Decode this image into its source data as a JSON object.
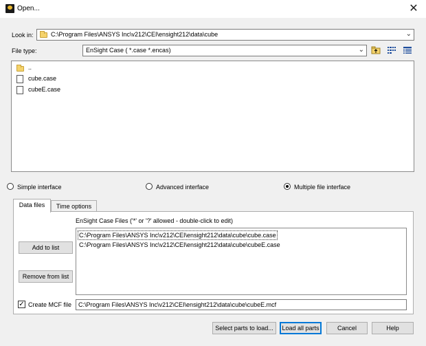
{
  "window": {
    "title": "Open...",
    "close_icon": "close-icon"
  },
  "look_in": {
    "label": "Look in:",
    "value": "C:\\Program Files\\ANSYS Inc\\v212\\CEI\\ensight212\\data\\cube"
  },
  "file_type": {
    "label": "File type:",
    "value": "EnSight Case ( *.case *.encas)"
  },
  "toolbar": {
    "icons": [
      "up-folder-icon",
      "list-view-icon",
      "detail-view-icon"
    ]
  },
  "file_list": {
    "items": [
      {
        "name": "..",
        "icon": "folder-icon"
      },
      {
        "name": "cube.case",
        "icon": "file-icon"
      },
      {
        "name": "cubeE.case",
        "icon": "file-icon"
      }
    ]
  },
  "interface": {
    "options": [
      "Simple interface",
      "Advanced interface",
      "Multiple file interface"
    ],
    "selected": "Multiple file interface"
  },
  "tabs": {
    "items": [
      "Data files",
      "Time options"
    ],
    "active": "Data files"
  },
  "data_files": {
    "list_label": "EnSight Case Files ('*' or '?' allowed - double-click to edit)",
    "entries": [
      "C:\\Program Files\\ANSYS Inc\\v212\\CEI\\ensight212\\data\\cube\\cube.case",
      "C:\\Program Files\\ANSYS Inc\\v212\\CEI\\ensight212\\data\\cube\\cubeE.case"
    ],
    "add_label": "Add to list",
    "remove_label": "Remove from list",
    "create_mcf_label": "Create MCF file",
    "create_mcf_checked": true,
    "mcf_path": "C:\\Program Files\\ANSYS Inc\\v212\\CEI\\ensight212\\data\\cube\\cubeE.mcf"
  },
  "buttons": {
    "select_parts": "Select parts to load...",
    "load_all": "Load all parts",
    "cancel": "Cancel",
    "help": "Help"
  }
}
